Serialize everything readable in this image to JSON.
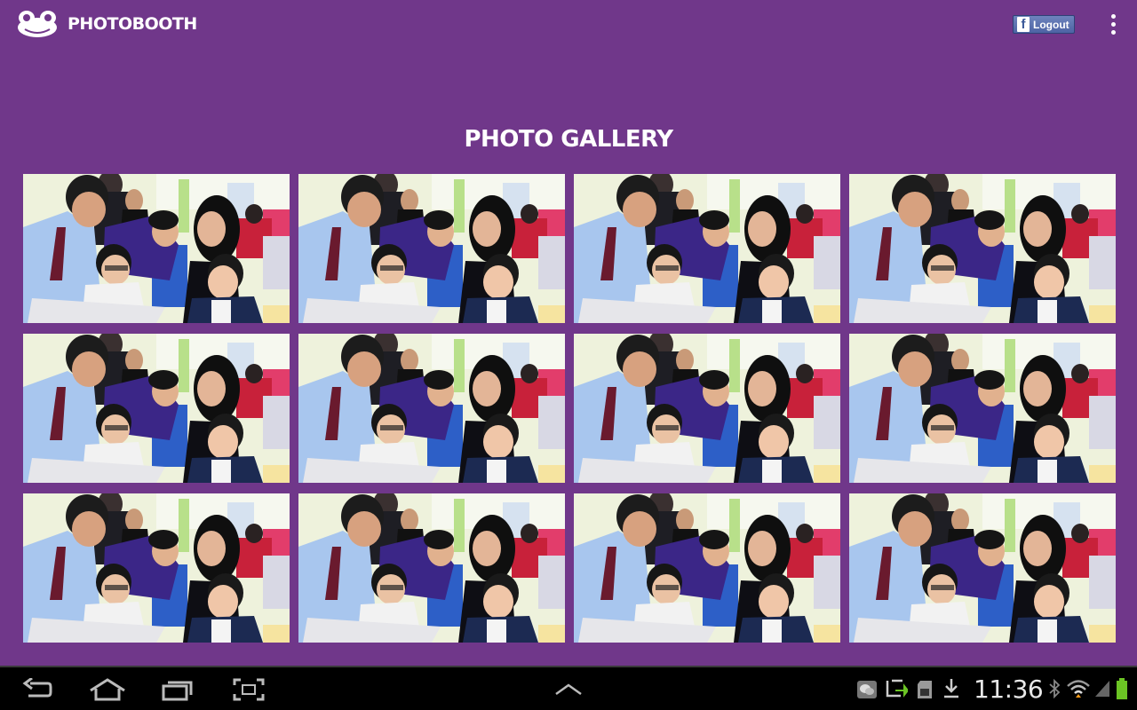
{
  "app": {
    "title": "PHOTOBOOTH",
    "logout_label": "Logout",
    "facebook_glyph": "f"
  },
  "gallery": {
    "title": "PHOTO GALLERY",
    "photo_count": 12
  },
  "system_bar": {
    "time": "11:36",
    "icons": [
      "back-icon",
      "home-icon",
      "recent-apps-icon",
      "screenshot-icon",
      "up-chevron-icon",
      "chat-icon",
      "sync-icon",
      "sd-card-icon",
      "download-icon",
      "bluetooth-icon",
      "wifi-icon",
      "signal-icon",
      "battery-icon"
    ]
  },
  "colors": {
    "background": "#70378a",
    "facebook": "#3b5998",
    "system_bar": "#000000"
  }
}
